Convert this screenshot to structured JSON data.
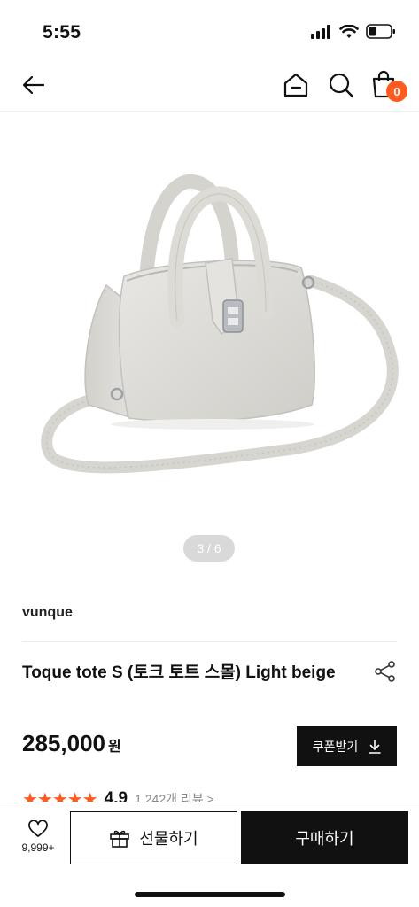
{
  "status_bar": {
    "time": "5:55"
  },
  "nav": {
    "cart_count": "0"
  },
  "gallery": {
    "counter": "3 / 6"
  },
  "product": {
    "brand": "vunque",
    "title": "Toque tote S (토크 토트 스몰) Light beige",
    "price": "285,000",
    "currency": "원",
    "rating": "4.9",
    "review_count": "1,242개 리뷰 >"
  },
  "coupon": {
    "label": "쿠폰받기"
  },
  "bottom_bar": {
    "wish_count": "9,999+",
    "gift_label": "선물하기",
    "buy_label": "구매하기"
  },
  "colors": {
    "accent": "#ff5a1f",
    "dark": "#111111",
    "bag": "#dcdbd6"
  }
}
